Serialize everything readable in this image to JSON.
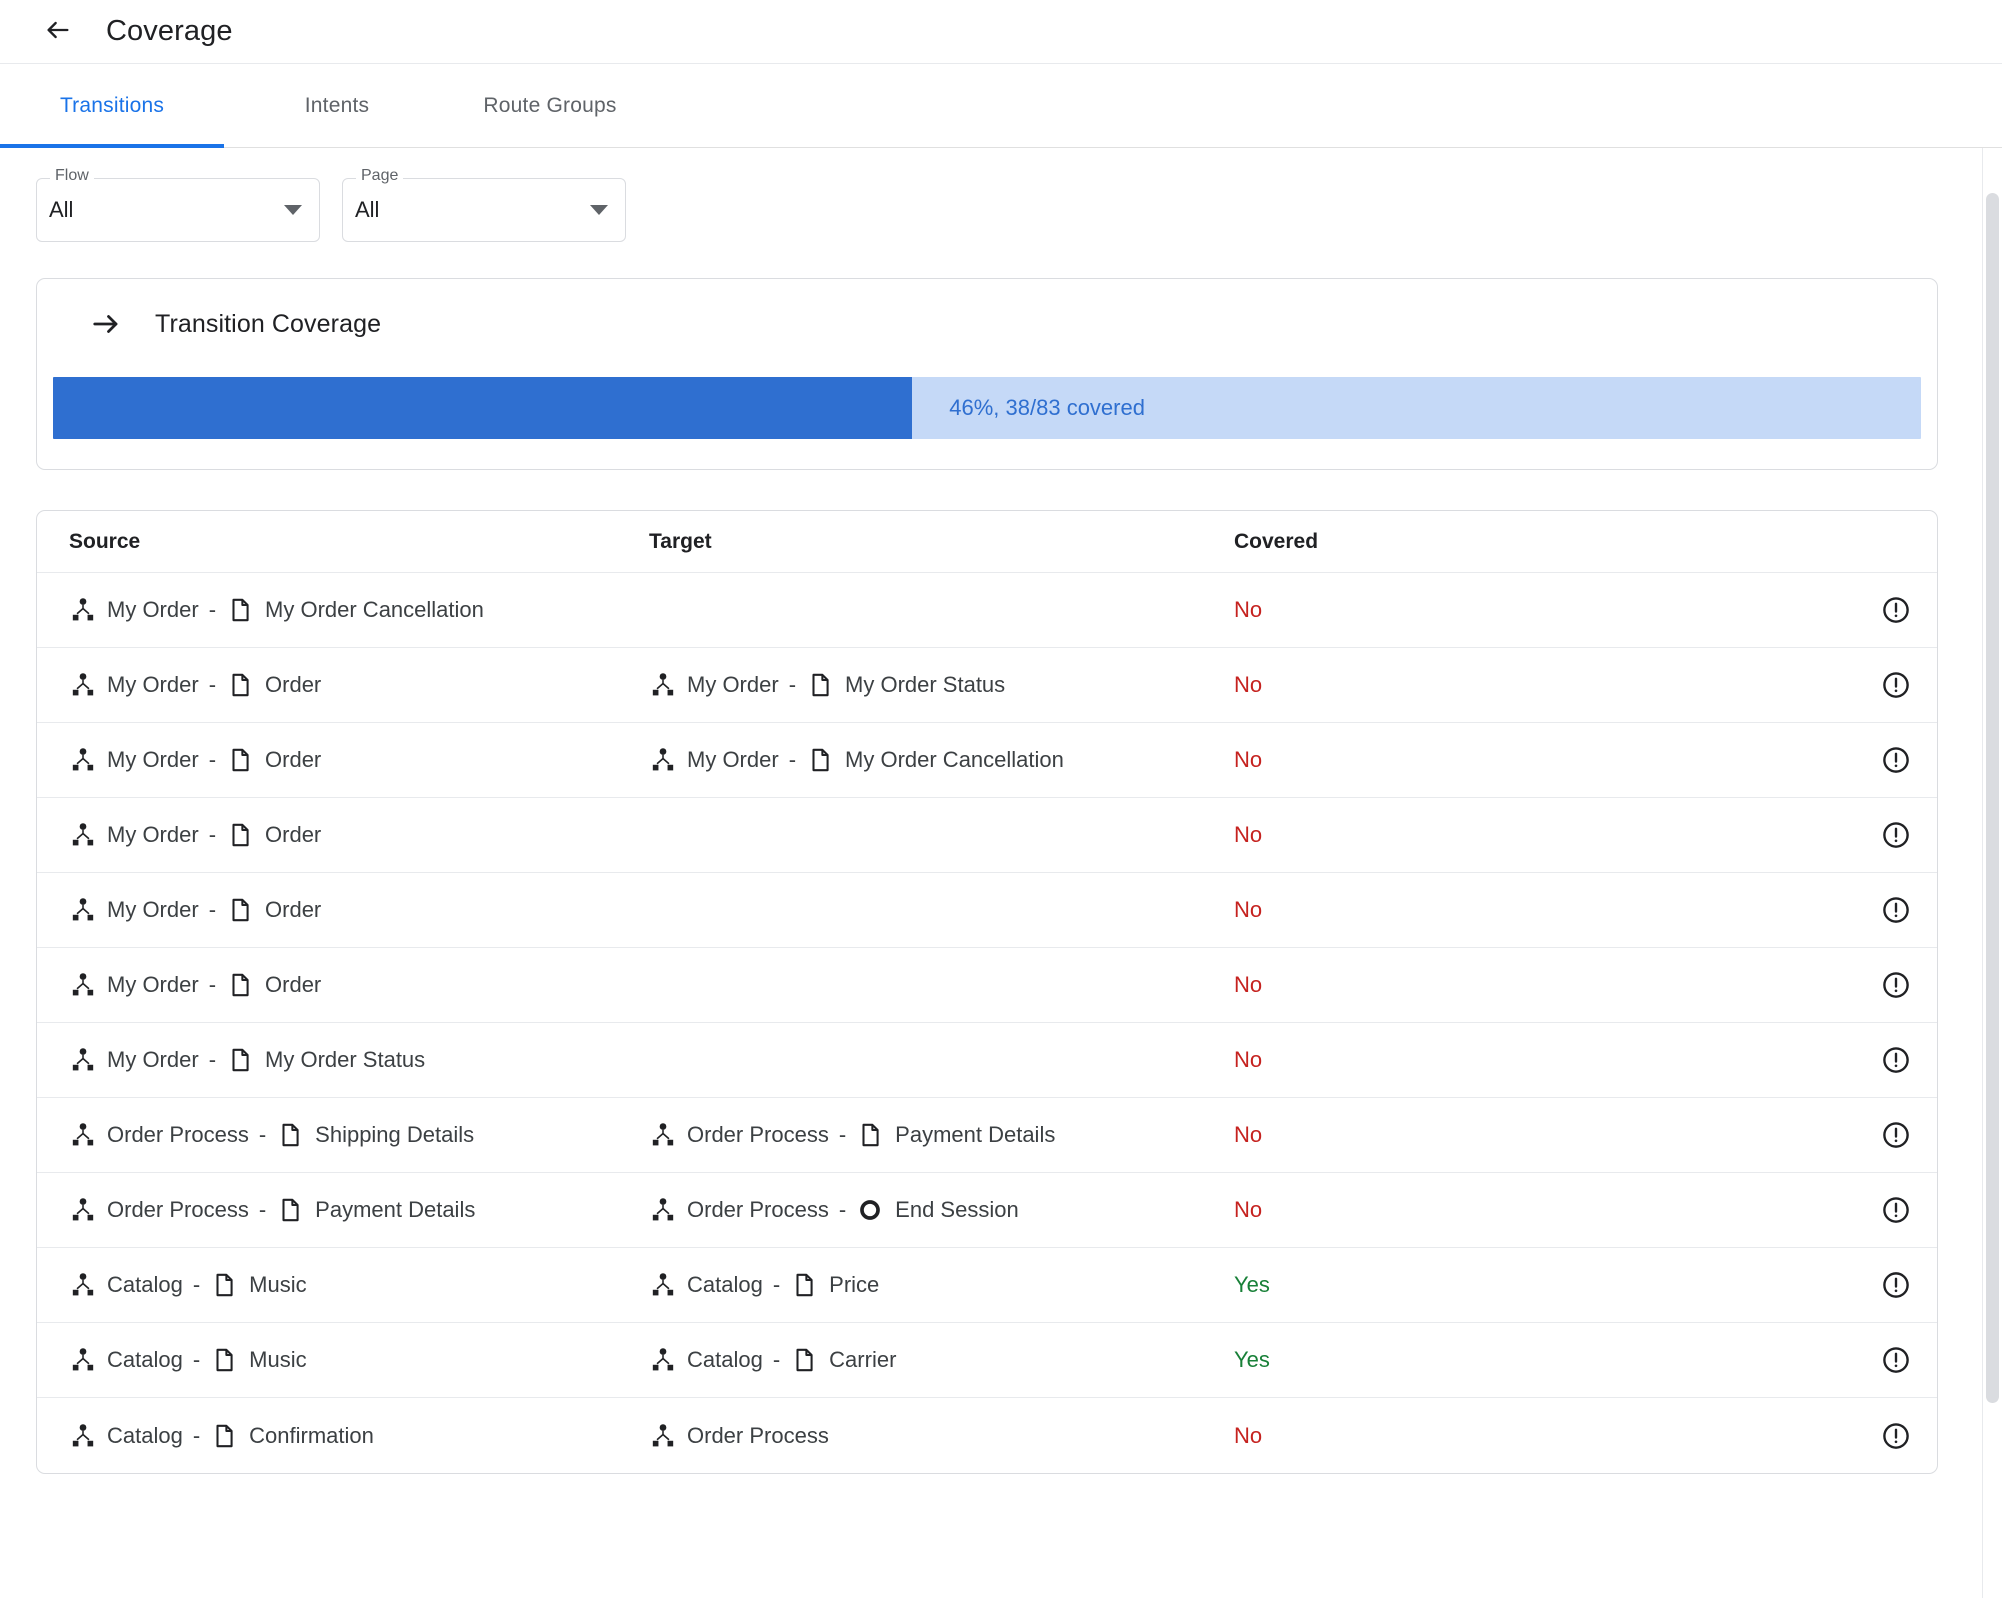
{
  "appbar": {
    "back_icon": "arrow-left-icon",
    "title": "Coverage"
  },
  "tabs": [
    {
      "label": "Transitions",
      "active": true
    },
    {
      "label": "Intents",
      "active": false
    },
    {
      "label": "Route Groups",
      "active": false
    }
  ],
  "filters": [
    {
      "label": "Flow",
      "value": "All",
      "icon": "chevron-down-icon"
    },
    {
      "label": "Page",
      "value": "All",
      "icon": "chevron-down-icon"
    }
  ],
  "coverage_card": {
    "icon": "arrow-right-icon",
    "title": "Transition Coverage",
    "percent": 46,
    "covered": 38,
    "total": 83,
    "progress_label": "46%, 38/83 covered",
    "fill_color": "#2f6fd0",
    "track_color": "#c5d9f7"
  },
  "table": {
    "headers": {
      "source": "Source",
      "target": "Target",
      "covered": "Covered"
    },
    "status_colors": {
      "yes": "#188038",
      "no": "#c5221f"
    },
    "row_icon": "error-outline-icon",
    "rows": [
      {
        "source": {
          "flow": "My Order",
          "flow_icon": "flow-icon",
          "sep": "-",
          "page": "My Order Cancellation",
          "page_icon": "page-icon"
        },
        "target": null,
        "covered": "No"
      },
      {
        "source": {
          "flow": "My Order",
          "flow_icon": "flow-icon",
          "sep": "-",
          "page": "Order",
          "page_icon": "page-icon"
        },
        "target": {
          "flow": "My Order",
          "flow_icon": "flow-icon",
          "sep": "-",
          "page": "My Order Status",
          "page_icon": "page-icon"
        },
        "covered": "No"
      },
      {
        "source": {
          "flow": "My Order",
          "flow_icon": "flow-icon",
          "sep": "-",
          "page": "Order",
          "page_icon": "page-icon"
        },
        "target": {
          "flow": "My Order",
          "flow_icon": "flow-icon",
          "sep": "-",
          "page": "My Order Cancellation",
          "page_icon": "page-icon"
        },
        "covered": "No"
      },
      {
        "source": {
          "flow": "My Order",
          "flow_icon": "flow-icon",
          "sep": "-",
          "page": "Order",
          "page_icon": "page-icon"
        },
        "target": null,
        "covered": "No"
      },
      {
        "source": {
          "flow": "My Order",
          "flow_icon": "flow-icon",
          "sep": "-",
          "page": "Order",
          "page_icon": "page-icon"
        },
        "target": null,
        "covered": "No"
      },
      {
        "source": {
          "flow": "My Order",
          "flow_icon": "flow-icon",
          "sep": "-",
          "page": "Order",
          "page_icon": "page-icon"
        },
        "target": null,
        "covered": "No"
      },
      {
        "source": {
          "flow": "My Order",
          "flow_icon": "flow-icon",
          "sep": "-",
          "page": "My Order Status",
          "page_icon": "page-icon"
        },
        "target": null,
        "covered": "No"
      },
      {
        "source": {
          "flow": "Order Process",
          "flow_icon": "flow-icon",
          "sep": "-",
          "page": "Shipping Details",
          "page_icon": "page-icon"
        },
        "target": {
          "flow": "Order Process",
          "flow_icon": "flow-icon",
          "sep": "-",
          "page": "Payment Details",
          "page_icon": "page-icon"
        },
        "covered": "No"
      },
      {
        "source": {
          "flow": "Order Process",
          "flow_icon": "flow-icon",
          "sep": "-",
          "page": "Payment Details",
          "page_icon": "page-icon"
        },
        "target": {
          "flow": "Order Process",
          "flow_icon": "flow-icon",
          "sep": "-",
          "page": "End Session",
          "page_icon": "session-icon"
        },
        "covered": "No"
      },
      {
        "source": {
          "flow": "Catalog",
          "flow_icon": "flow-icon",
          "sep": "-",
          "page": "Music",
          "page_icon": "page-icon"
        },
        "target": {
          "flow": "Catalog",
          "flow_icon": "flow-icon",
          "sep": "-",
          "page": "Price",
          "page_icon": "page-icon"
        },
        "covered": "Yes"
      },
      {
        "source": {
          "flow": "Catalog",
          "flow_icon": "flow-icon",
          "sep": "-",
          "page": "Music",
          "page_icon": "page-icon"
        },
        "target": {
          "flow": "Catalog",
          "flow_icon": "flow-icon",
          "sep": "-",
          "page": "Carrier",
          "page_icon": "page-icon"
        },
        "covered": "Yes"
      },
      {
        "source": {
          "flow": "Catalog",
          "flow_icon": "flow-icon",
          "sep": "-",
          "page": "Confirmation",
          "page_icon": "page-icon"
        },
        "target": {
          "flow": "Order Process",
          "flow_icon": "flow-icon",
          "sep": "",
          "page": "",
          "page_icon": ""
        },
        "covered": "No"
      }
    ]
  }
}
